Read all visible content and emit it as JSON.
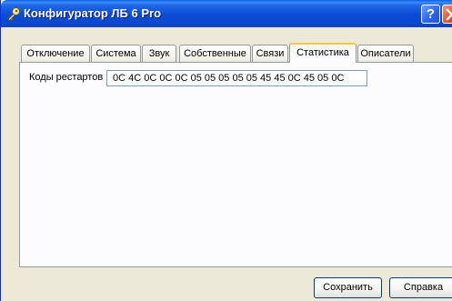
{
  "window": {
    "title": "Конфигуратор ЛБ 6 Pro",
    "help_button": "?"
  },
  "tabs": [
    {
      "label": "Отключение"
    },
    {
      "label": "Система"
    },
    {
      "label": "Звук"
    },
    {
      "label": "Собственные"
    },
    {
      "label": "Связи"
    },
    {
      "label": "Статистика",
      "active": true
    },
    {
      "label": "Описатели"
    }
  ],
  "statistics": {
    "restart_codes_label": "Коды рестартов",
    "restart_codes_value": "0C 4C 0C 0C 0C 05 05 05 05 05 45 45 0C 45 05 0C"
  },
  "footer": {
    "save_label": "Сохранить",
    "help_label": "Справка"
  },
  "colors": {
    "titlebar": "#0a4bd6",
    "window_face": "#ece9d8",
    "active_tab_accent": "#ffc83c",
    "close_button": "#e0532c"
  },
  "icons": [
    "key-icon",
    "question-icon",
    "close-icon"
  ]
}
